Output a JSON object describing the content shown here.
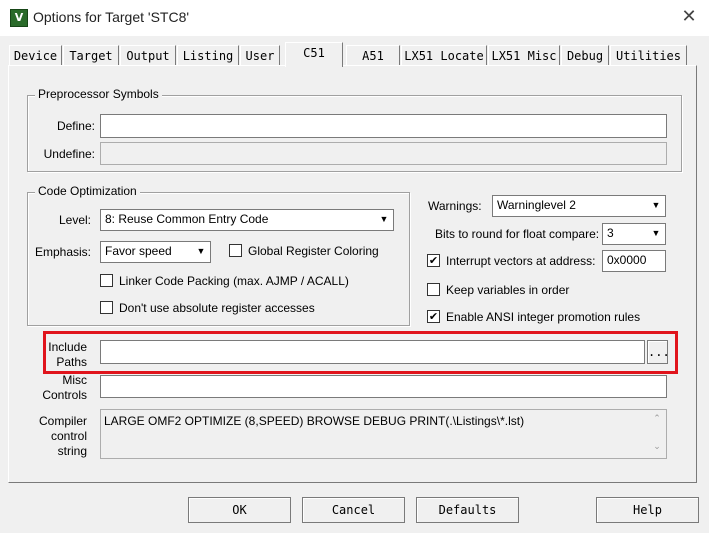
{
  "window": {
    "title": "Options for Target 'STC8'",
    "app_icon_letter": "V",
    "close_symbol": "✕"
  },
  "tabs": [
    {
      "label": "Device"
    },
    {
      "label": "Target"
    },
    {
      "label": "Output"
    },
    {
      "label": "Listing"
    },
    {
      "label": "User"
    },
    {
      "label": "C51",
      "active": true
    },
    {
      "label": "A51"
    },
    {
      "label": "LX51 Locate"
    },
    {
      "label": "LX51 Misc"
    },
    {
      "label": "Debug"
    },
    {
      "label": "Utilities"
    }
  ],
  "preprocessor": {
    "group_label": "Preprocessor Symbols",
    "define_label": "Define:",
    "define_value": "",
    "undefine_label": "Undefine:",
    "undefine_value": ""
  },
  "code_optimization": {
    "group_label": "Code Optimization",
    "level_label": "Level:",
    "level_value": "8: Reuse Common Entry Code",
    "emphasis_label": "Emphasis:",
    "emphasis_value": "Favor speed",
    "global_register_coloring": {
      "label": "Global Register Coloring",
      "checked": false
    },
    "linker_code_packing": {
      "label": "Linker Code Packing (max. AJMP / ACALL)",
      "checked": false
    },
    "dont_use_absolute": {
      "label": "Don't use absolute register accesses",
      "checked": false
    }
  },
  "options_right": {
    "warnings_label": "Warnings:",
    "warnings_value": "Warninglevel 2",
    "bits_label": "Bits to round for float compare:",
    "bits_value": "3",
    "interrupt_vectors": {
      "label": "Interrupt vectors at address:",
      "checked": true,
      "value": "0x0000"
    },
    "keep_variables": {
      "label": "Keep variables in order",
      "checked": false
    },
    "enable_ansi": {
      "label": "Enable ANSI integer promotion rules",
      "checked": true
    }
  },
  "paths": {
    "include_label_line1": "Include",
    "include_label_line2": "Paths",
    "include_value": "",
    "browse_label": "...",
    "misc_label_line1": "Misc",
    "misc_label_line2": "Controls",
    "misc_value": "",
    "compiler_label_line1": "Compiler",
    "compiler_label_line2": "control",
    "compiler_label_line3": "string",
    "compiler_value": "LARGE OMF2 OPTIMIZE (8,SPEED) BROWSE DEBUG PRINT(.\\Listings\\*.lst)"
  },
  "buttons": {
    "ok": "OK",
    "cancel": "Cancel",
    "defaults": "Defaults",
    "help": "Help"
  },
  "colors": {
    "highlight": "#e0141c",
    "dialog_bg": "#f0f0f0"
  }
}
